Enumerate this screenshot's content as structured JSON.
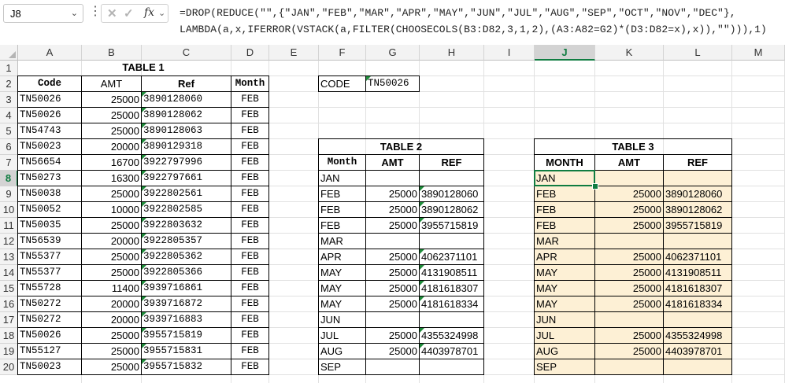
{
  "formula_bar": {
    "name_box": "J8",
    "formula_line1": "=DROP(REDUCE(\"\",{\"JAN\",\"FEB\",\"MAR\",\"APR\",\"MAY\",\"JUN\",\"JUL\",\"AUG\",\"SEP\",\"OCT\",\"NOV\",\"DEC\"},",
    "formula_line2": "LAMBDA(a,x,IFERROR(VSTACK(a,FILTER(CHOOSECOLS(B3:D82,3,1,2),(A3:A82=G2)*(D3:D82=x),x)),\"\"))),1)"
  },
  "columns": [
    "A",
    "B",
    "C",
    "D",
    "E",
    "F",
    "G",
    "H",
    "I",
    "J",
    "K",
    "L",
    "M"
  ],
  "rows": [
    1,
    2,
    3,
    4,
    5,
    6,
    7,
    8,
    9,
    10,
    11,
    12,
    13,
    14,
    15,
    16,
    17,
    18,
    19,
    20
  ],
  "active_cell": "J8",
  "table1": {
    "title": "TABLE 1",
    "headers": [
      "Code",
      "AMT",
      "Ref",
      "Month"
    ],
    "rows": [
      [
        "TN50026",
        "25000",
        "3890128060",
        "FEB"
      ],
      [
        "TN50026",
        "25000",
        "3890128062",
        "FEB"
      ],
      [
        "TN54743",
        "25000",
        "3890128063",
        "FEB"
      ],
      [
        "TN50023",
        "20000",
        "3890129318",
        "FEB"
      ],
      [
        "TN56654",
        "16700",
        "3922797996",
        "FEB"
      ],
      [
        "TN50273",
        "16300",
        "3922797661",
        "FEB"
      ],
      [
        "TN50038",
        "25000",
        "3922802561",
        "FEB"
      ],
      [
        "TN50052",
        "10000",
        "3922802585",
        "FEB"
      ],
      [
        "TN50035",
        "25000",
        "3922803632",
        "FEB"
      ],
      [
        "TN56539",
        "20000",
        "3922805357",
        "FEB"
      ],
      [
        "TN55377",
        "25000",
        "3922805362",
        "FEB"
      ],
      [
        "TN55377",
        "25000",
        "3922805366",
        "FEB"
      ],
      [
        "TN55728",
        "11400",
        "3939716861",
        "FEB"
      ],
      [
        "TN50272",
        "20000",
        "3939716872",
        "FEB"
      ],
      [
        "TN50272",
        "20000",
        "3939716883",
        "FEB"
      ],
      [
        "TN50026",
        "25000",
        "3955715819",
        "FEB"
      ],
      [
        "TN55127",
        "25000",
        "3955715831",
        "FEB"
      ],
      [
        "TN50023",
        "25000",
        "3955715832",
        "FEB"
      ]
    ]
  },
  "lookup": {
    "label": "CODE",
    "value": "TN50026"
  },
  "table2": {
    "title": "TABLE 2",
    "headers": [
      "Month",
      "AMT",
      "REF"
    ],
    "rows": [
      [
        "JAN",
        "",
        ""
      ],
      [
        "FEB",
        "25000",
        "3890128060"
      ],
      [
        "FEB",
        "25000",
        "3890128062"
      ],
      [
        "FEB",
        "25000",
        "3955715819"
      ],
      [
        "MAR",
        "",
        ""
      ],
      [
        "APR",
        "25000",
        "4062371101"
      ],
      [
        "MAY",
        "25000",
        "4131908511"
      ],
      [
        "MAY",
        "25000",
        "4181618307"
      ],
      [
        "MAY",
        "25000",
        "4181618334"
      ],
      [
        "JUN",
        "",
        ""
      ],
      [
        "JUL",
        "25000",
        "4355324998"
      ],
      [
        "AUG",
        "25000",
        "4403978701"
      ],
      [
        "SEP",
        "",
        ""
      ]
    ]
  },
  "table3": {
    "title": "TABLE 3",
    "headers": [
      "MONTH",
      "AMT",
      "REF"
    ],
    "rows": [
      [
        "JAN",
        "",
        ""
      ],
      [
        "FEB",
        "25000",
        "3890128060"
      ],
      [
        "FEB",
        "25000",
        "3890128062"
      ],
      [
        "FEB",
        "25000",
        "3955715819"
      ],
      [
        "MAR",
        "",
        ""
      ],
      [
        "APR",
        "25000",
        "4062371101"
      ],
      [
        "MAY",
        "25000",
        "4131908511"
      ],
      [
        "MAY",
        "25000",
        "4181618307"
      ],
      [
        "MAY",
        "25000",
        "4181618334"
      ],
      [
        "JUN",
        "",
        ""
      ],
      [
        "JUL",
        "25000",
        "4355324998"
      ],
      [
        "AUG",
        "25000",
        "4403978701"
      ],
      [
        "SEP",
        "",
        ""
      ]
    ]
  },
  "colors": {
    "accent": "#107c41",
    "spill_fill": "#fdf0d5",
    "note_marker": "#1e8c3a"
  }
}
